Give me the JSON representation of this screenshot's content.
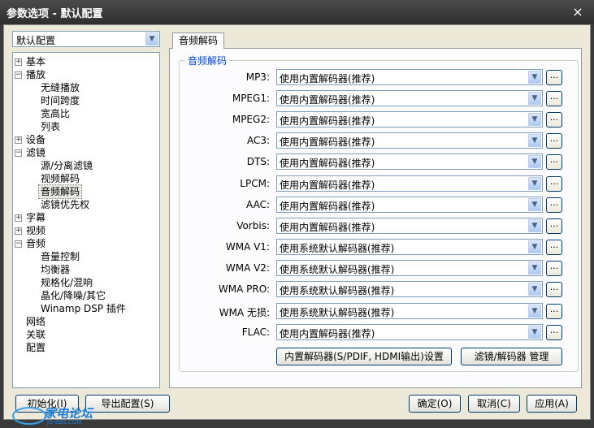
{
  "window": {
    "title": "参数选项 - 默认配置",
    "close_glyph": "×"
  },
  "profile": {
    "value": "默认配置"
  },
  "tree": {
    "basic": "基本",
    "playback": "播放",
    "gapless": "无缝播放",
    "timestretch": "时间跨度",
    "aspect": "宽高比",
    "list": "列表",
    "device": "设备",
    "filter": "滤镜",
    "splitter": "源/分离滤镜",
    "video_decode": "视频解码",
    "audio_decode": "音频解码",
    "filter_priority": "滤镜优先权",
    "subtitle": "字幕",
    "video": "视频",
    "audio": "音频",
    "volume": "音量控制",
    "equalizer": "均衡器",
    "normalize": "规格化/混响",
    "crystal": "晶化/降噪/其它",
    "winamp": "Winamp DSP 插件",
    "network": "网络",
    "assoc": "关联",
    "config": "配置"
  },
  "tab": {
    "label": "音频解码"
  },
  "group": {
    "title": "音频解码"
  },
  "decoders": [
    {
      "label": "MP3:",
      "value": "使用内置解码器(推荐)"
    },
    {
      "label": "MPEG1:",
      "value": "使用内置解码器(推荐)"
    },
    {
      "label": "MPEG2:",
      "value": "使用内置解码器(推荐)"
    },
    {
      "label": "AC3:",
      "value": "使用内置解码器(推荐)"
    },
    {
      "label": "DTS:",
      "value": "使用内置解码器(推荐)"
    },
    {
      "label": "LPCM:",
      "value": "使用内置解码器(推荐)"
    },
    {
      "label": "AAC:",
      "value": "使用内置解码器(推荐)"
    },
    {
      "label": "Vorbis:",
      "value": "使用内置解码器(推荐)"
    },
    {
      "label": "WMA V1:",
      "value": "使用系统默认解码器(推荐)"
    },
    {
      "label": "WMA V2:",
      "value": "使用系统默认解码器(推荐)"
    },
    {
      "label": "WMA PRO:",
      "value": "使用系统默认解码器(推荐)"
    },
    {
      "label": "WMA 无损:",
      "value": "使用系统默认解码器(推荐)"
    },
    {
      "label": "FLAC:",
      "value": "使用内置解码器(推荐)"
    }
  ],
  "dots_label": "...",
  "buttons": {
    "builtin_settings": "内置解码器(S/PDIF, HDMI输出)设置",
    "filter_manage": "滤镜/解码器 管理",
    "init": "初始化(I)",
    "export": "导出配置(S)",
    "ok": "确定(O)",
    "cancel": "取消(C)",
    "apply": "应用(A)"
  },
  "watermark": {
    "text": "家电论坛",
    "sub": "JD-BBS.COM"
  }
}
